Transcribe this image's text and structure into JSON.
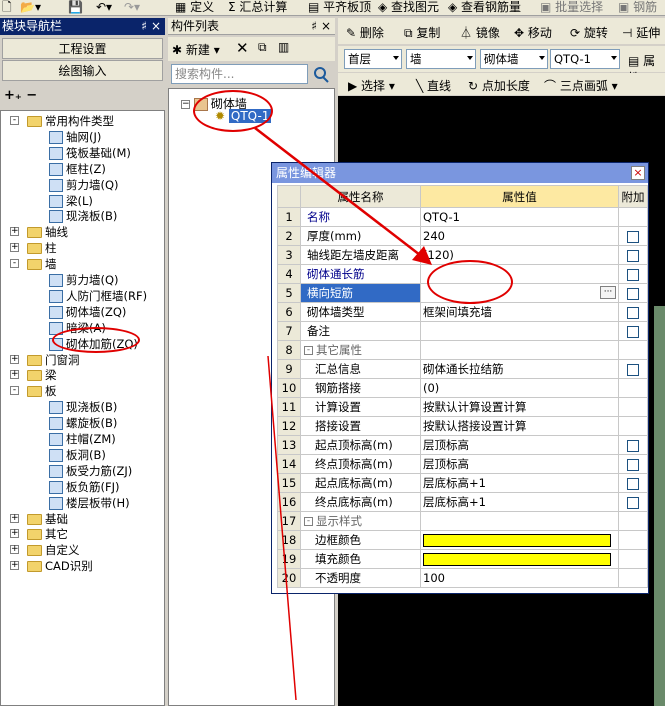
{
  "top_toolbar": {
    "define": "定义",
    "sum": "汇总计算",
    "flat": "平齐板顶",
    "find": "查找图元",
    "view_rebar": "查看钢筋量",
    "batch": "批量选择",
    "rebar": "钢筋"
  },
  "nav": {
    "title": "模块导航栏",
    "pin": "♯",
    "close": "×",
    "project_settings": "工程设置",
    "drawing_input": "绘图输入",
    "tree": [
      {
        "label": "常用构件类型",
        "level": 0,
        "kind": "folder",
        "pm": "-"
      },
      {
        "label": "轴网(J)",
        "level": 1,
        "kind": "item"
      },
      {
        "label": "筏板基础(M)",
        "level": 1,
        "kind": "item"
      },
      {
        "label": "框柱(Z)",
        "level": 1,
        "kind": "item"
      },
      {
        "label": "剪力墙(Q)",
        "level": 1,
        "kind": "item"
      },
      {
        "label": "梁(L)",
        "level": 1,
        "kind": "item"
      },
      {
        "label": "现浇板(B)",
        "level": 1,
        "kind": "item"
      },
      {
        "label": "轴线",
        "level": 0,
        "kind": "folder",
        "pm": "+"
      },
      {
        "label": "柱",
        "level": 0,
        "kind": "folder",
        "pm": "+"
      },
      {
        "label": "墙",
        "level": 0,
        "kind": "folder",
        "pm": "-"
      },
      {
        "label": "剪力墙(Q)",
        "level": 1,
        "kind": "item"
      },
      {
        "label": "人防门框墙(RF)",
        "level": 1,
        "kind": "item"
      },
      {
        "label": "砌体墙(ZQ)",
        "level": 1,
        "kind": "item"
      },
      {
        "label": "暗梁(A)",
        "level": 1,
        "kind": "item"
      },
      {
        "label": "砌体加筋(ZQ)",
        "level": 1,
        "kind": "item"
      },
      {
        "label": "门窗洞",
        "level": 0,
        "kind": "folder",
        "pm": "+"
      },
      {
        "label": "梁",
        "level": 0,
        "kind": "folder",
        "pm": "+"
      },
      {
        "label": "板",
        "level": 0,
        "kind": "folder",
        "pm": "-"
      },
      {
        "label": "现浇板(B)",
        "level": 1,
        "kind": "item"
      },
      {
        "label": "螺旋板(B)",
        "level": 1,
        "kind": "item"
      },
      {
        "label": "柱帽(ZM)",
        "level": 1,
        "kind": "item"
      },
      {
        "label": "板洞(B)",
        "level": 1,
        "kind": "item"
      },
      {
        "label": "板受力筋(ZJ)",
        "level": 1,
        "kind": "item"
      },
      {
        "label": "板负筋(FJ)",
        "level": 1,
        "kind": "item"
      },
      {
        "label": "楼层板带(H)",
        "level": 1,
        "kind": "item"
      },
      {
        "label": "基础",
        "level": 0,
        "kind": "folder",
        "pm": "+"
      },
      {
        "label": "其它",
        "level": 0,
        "kind": "folder",
        "pm": "+"
      },
      {
        "label": "自定义",
        "level": 0,
        "kind": "folder",
        "pm": "+"
      },
      {
        "label": "CAD识别",
        "level": 0,
        "kind": "folder",
        "pm": "+"
      }
    ]
  },
  "components": {
    "title": "构件列表",
    "pin": "♯",
    "close": "×",
    "new_label": "新建",
    "search_placeholder": "搜索构件...",
    "root": "砌体墙",
    "selected": "QTQ-1"
  },
  "right_toolbar": {
    "delete": "删除",
    "copy": "复制",
    "mirror": "镜像",
    "move": "移动",
    "rotate": "旋转",
    "extend": "延伸",
    "floor": "首层",
    "category": "墙",
    "type": "砌体墙",
    "instance": "QTQ-1",
    "attr": "属性",
    "select": "选择",
    "line": "直线",
    "point_length": "点加长度",
    "arc": "三点画弧"
  },
  "dialog": {
    "title": "属性编辑器",
    "close": "×",
    "col_name": "属性名称",
    "col_value": "属性值",
    "col_add": "附加",
    "rows": [
      {
        "no": "1",
        "name": "名称",
        "value": "QTQ-1",
        "blue": true,
        "cb": false,
        "indent": 0
      },
      {
        "no": "2",
        "name": "厚度(mm)",
        "value": "240",
        "blue": false,
        "cb": true,
        "indent": 0
      },
      {
        "no": "3",
        "name": "轴线距左墙皮距离",
        "value": "(120)",
        "blue": false,
        "cb": true,
        "indent": 0
      },
      {
        "no": "4",
        "name": "砌体通长筋",
        "value": "",
        "blue": true,
        "cb": true,
        "indent": 0
      },
      {
        "no": "5",
        "name": "横向短筋",
        "value": "",
        "blue": true,
        "cb": true,
        "indent": 0,
        "selected": true
      },
      {
        "no": "6",
        "name": "砌体墙类型",
        "value": "框架间填充墙",
        "blue": false,
        "cb": true,
        "indent": 0
      },
      {
        "no": "7",
        "name": "备注",
        "value": "",
        "blue": false,
        "cb": true,
        "indent": 0
      },
      {
        "no": "8",
        "name": "其它属性",
        "value": "",
        "group": true,
        "pm": "-"
      },
      {
        "no": "9",
        "name": "汇总信息",
        "value": "砌体通长拉结筋",
        "blue": false,
        "cb": true,
        "indent": 1
      },
      {
        "no": "10",
        "name": "钢筋搭接",
        "value": "(0)",
        "blue": false,
        "cb": false,
        "indent": 1
      },
      {
        "no": "11",
        "name": "计算设置",
        "value": "按默认计算设置计算",
        "blue": false,
        "cb": false,
        "indent": 1
      },
      {
        "no": "12",
        "name": "搭接设置",
        "value": "按默认搭接设置计算",
        "blue": false,
        "cb": false,
        "indent": 1
      },
      {
        "no": "13",
        "name": "起点顶标高(m)",
        "value": "层顶标高",
        "blue": false,
        "cb": true,
        "indent": 1
      },
      {
        "no": "14",
        "name": "终点顶标高(m)",
        "value": "层顶标高",
        "blue": false,
        "cb": true,
        "indent": 1
      },
      {
        "no": "15",
        "name": "起点底标高(m)",
        "value": "层底标高+1",
        "blue": false,
        "cb": true,
        "indent": 1
      },
      {
        "no": "16",
        "name": "终点底标高(m)",
        "value": "层底标高+1",
        "blue": false,
        "cb": true,
        "indent": 1
      },
      {
        "no": "17",
        "name": "显示样式",
        "value": "",
        "group": true,
        "pm": "-"
      },
      {
        "no": "18",
        "name": "边框颜色",
        "value": "",
        "color": "#ffff00",
        "indent": 1
      },
      {
        "no": "19",
        "name": "填充颜色",
        "value": "",
        "color": "#ffff00",
        "indent": 1
      },
      {
        "no": "20",
        "name": "不透明度",
        "value": "100",
        "blue": false,
        "cb": false,
        "indent": 1
      }
    ]
  },
  "colors": {
    "annotation": "#e00000",
    "title_active": "#0a246a",
    "dialog_title": "#7a96df",
    "highlight": "#ffff00"
  }
}
